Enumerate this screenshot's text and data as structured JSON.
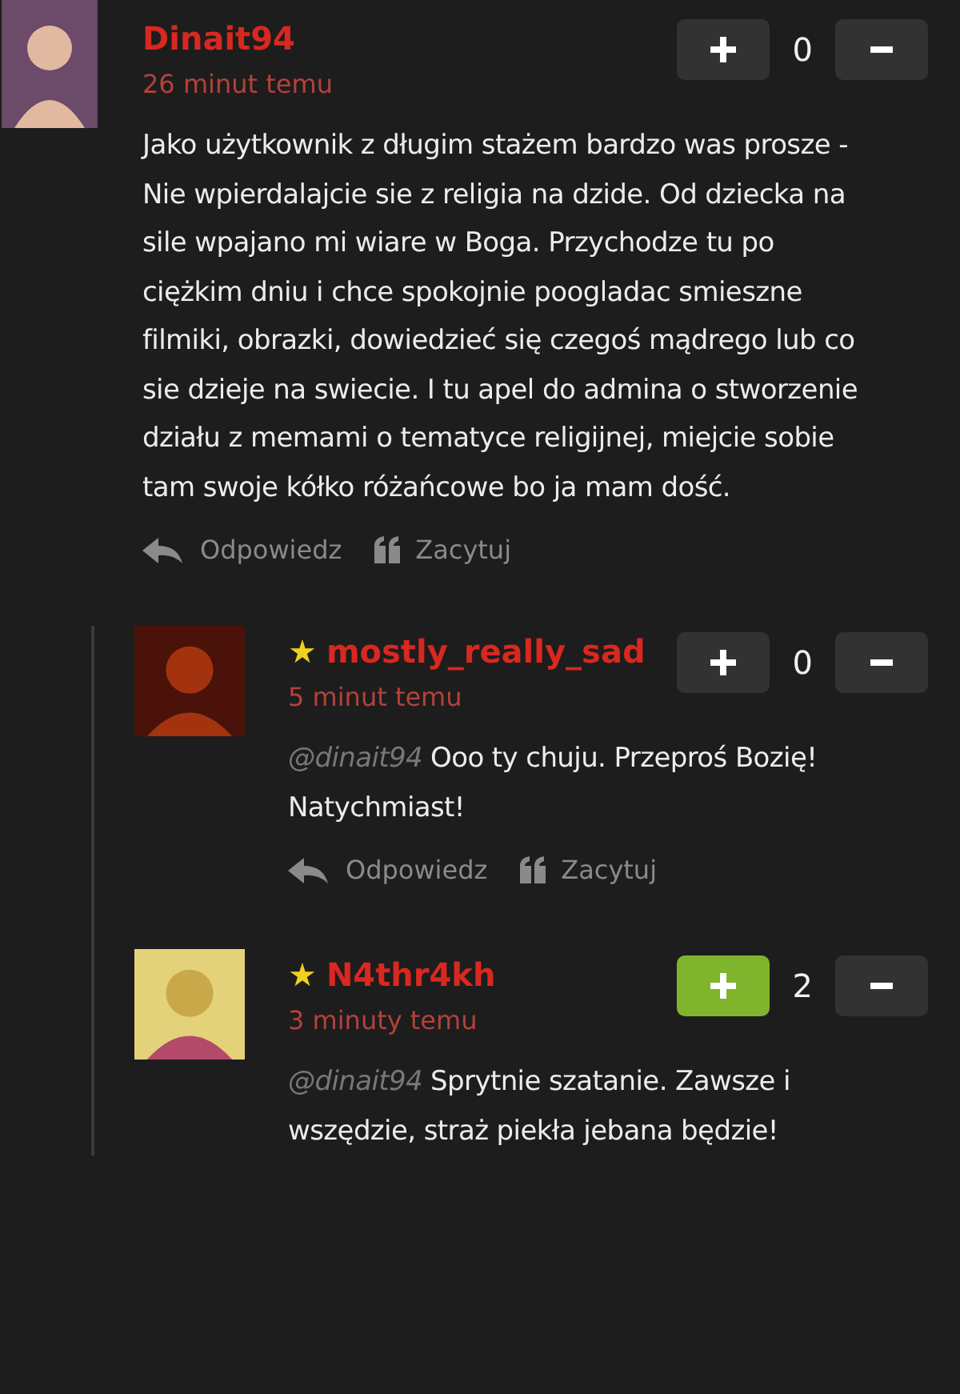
{
  "comments": [
    {
      "author": "Dinait94",
      "time": "26 minut temu",
      "text": "Jako użytkownik z długim stażem bardzo was prosze - Nie wpierdalajcie sie z religia na dzide. Od dziecka na sile wpajano mi wiare w Boga. Przychodze tu po ciężkim dniu i chce spokojnie poogladac smieszne filmiki, obrazki, dowiedzieć się czegoś mądrego lub co sie dzieje na swiecie. I tu apel do admina o stworzenie działu z memami o tematyce religijnej, miejcie sobie tam swoje kółko różańcowe bo ja mam dość.",
      "score": "0",
      "upvoted": false,
      "actions": [
        "Odpowiedz",
        "Zacytuj"
      ],
      "children": [
        {
          "star": "★",
          "author": "mostly_really_sad",
          "time": "5 minut temu",
          "mention": "@dinait94",
          "text": "Ooo ty chuju. Przeproś Bozię! Natychmiast!",
          "score": "0",
          "upvoted": false,
          "actions": [
            "Odpowiedz",
            "Zacytuj"
          ]
        },
        {
          "star": "★",
          "author": "N4thr4kh",
          "time": "3 minuty temu",
          "mention": "@dinait94",
          "text": "Sprytnie szatanie. Zawsze i wszędzie, straż piekła jebana będzie!",
          "score": "2",
          "upvoted": true
        }
      ]
    }
  ]
}
